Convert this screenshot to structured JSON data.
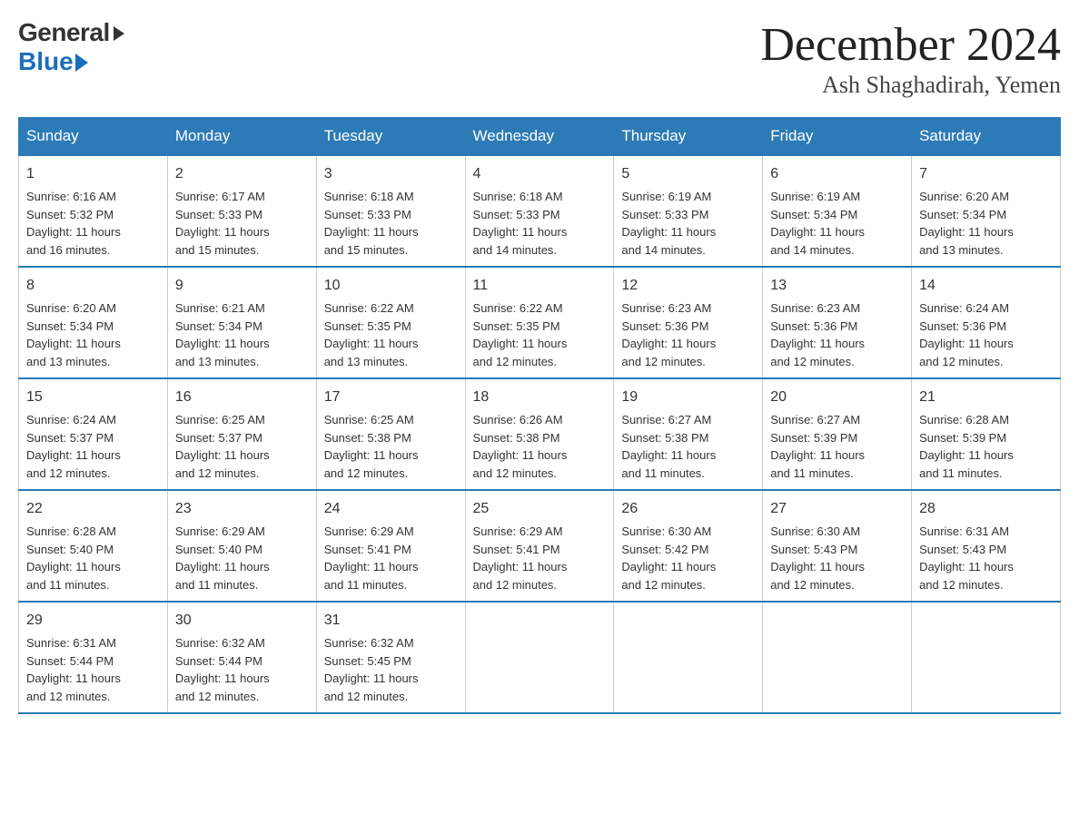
{
  "logo": {
    "general": "General",
    "blue": "Blue"
  },
  "title": {
    "month": "December 2024",
    "location": "Ash Shaghadirah, Yemen"
  },
  "headers": [
    "Sunday",
    "Monday",
    "Tuesday",
    "Wednesday",
    "Thursday",
    "Friday",
    "Saturday"
  ],
  "weeks": [
    [
      {
        "day": "1",
        "sunrise": "6:16 AM",
        "sunset": "5:32 PM",
        "daylight": "11 hours and 16 minutes."
      },
      {
        "day": "2",
        "sunrise": "6:17 AM",
        "sunset": "5:33 PM",
        "daylight": "11 hours and 15 minutes."
      },
      {
        "day": "3",
        "sunrise": "6:18 AM",
        "sunset": "5:33 PM",
        "daylight": "11 hours and 15 minutes."
      },
      {
        "day": "4",
        "sunrise": "6:18 AM",
        "sunset": "5:33 PM",
        "daylight": "11 hours and 14 minutes."
      },
      {
        "day": "5",
        "sunrise": "6:19 AM",
        "sunset": "5:33 PM",
        "daylight": "11 hours and 14 minutes."
      },
      {
        "day": "6",
        "sunrise": "6:19 AM",
        "sunset": "5:34 PM",
        "daylight": "11 hours and 14 minutes."
      },
      {
        "day": "7",
        "sunrise": "6:20 AM",
        "sunset": "5:34 PM",
        "daylight": "11 hours and 13 minutes."
      }
    ],
    [
      {
        "day": "8",
        "sunrise": "6:20 AM",
        "sunset": "5:34 PM",
        "daylight": "11 hours and 13 minutes."
      },
      {
        "day": "9",
        "sunrise": "6:21 AM",
        "sunset": "5:34 PM",
        "daylight": "11 hours and 13 minutes."
      },
      {
        "day": "10",
        "sunrise": "6:22 AM",
        "sunset": "5:35 PM",
        "daylight": "11 hours and 13 minutes."
      },
      {
        "day": "11",
        "sunrise": "6:22 AM",
        "sunset": "5:35 PM",
        "daylight": "11 hours and 12 minutes."
      },
      {
        "day": "12",
        "sunrise": "6:23 AM",
        "sunset": "5:36 PM",
        "daylight": "11 hours and 12 minutes."
      },
      {
        "day": "13",
        "sunrise": "6:23 AM",
        "sunset": "5:36 PM",
        "daylight": "11 hours and 12 minutes."
      },
      {
        "day": "14",
        "sunrise": "6:24 AM",
        "sunset": "5:36 PM",
        "daylight": "11 hours and 12 minutes."
      }
    ],
    [
      {
        "day": "15",
        "sunrise": "6:24 AM",
        "sunset": "5:37 PM",
        "daylight": "11 hours and 12 minutes."
      },
      {
        "day": "16",
        "sunrise": "6:25 AM",
        "sunset": "5:37 PM",
        "daylight": "11 hours and 12 minutes."
      },
      {
        "day": "17",
        "sunrise": "6:25 AM",
        "sunset": "5:38 PM",
        "daylight": "11 hours and 12 minutes."
      },
      {
        "day": "18",
        "sunrise": "6:26 AM",
        "sunset": "5:38 PM",
        "daylight": "11 hours and 12 minutes."
      },
      {
        "day": "19",
        "sunrise": "6:27 AM",
        "sunset": "5:38 PM",
        "daylight": "11 hours and 11 minutes."
      },
      {
        "day": "20",
        "sunrise": "6:27 AM",
        "sunset": "5:39 PM",
        "daylight": "11 hours and 11 minutes."
      },
      {
        "day": "21",
        "sunrise": "6:28 AM",
        "sunset": "5:39 PM",
        "daylight": "11 hours and 11 minutes."
      }
    ],
    [
      {
        "day": "22",
        "sunrise": "6:28 AM",
        "sunset": "5:40 PM",
        "daylight": "11 hours and 11 minutes."
      },
      {
        "day": "23",
        "sunrise": "6:29 AM",
        "sunset": "5:40 PM",
        "daylight": "11 hours and 11 minutes."
      },
      {
        "day": "24",
        "sunrise": "6:29 AM",
        "sunset": "5:41 PM",
        "daylight": "11 hours and 11 minutes."
      },
      {
        "day": "25",
        "sunrise": "6:29 AM",
        "sunset": "5:41 PM",
        "daylight": "11 hours and 12 minutes."
      },
      {
        "day": "26",
        "sunrise": "6:30 AM",
        "sunset": "5:42 PM",
        "daylight": "11 hours and 12 minutes."
      },
      {
        "day": "27",
        "sunrise": "6:30 AM",
        "sunset": "5:43 PM",
        "daylight": "11 hours and 12 minutes."
      },
      {
        "day": "28",
        "sunrise": "6:31 AM",
        "sunset": "5:43 PM",
        "daylight": "11 hours and 12 minutes."
      }
    ],
    [
      {
        "day": "29",
        "sunrise": "6:31 AM",
        "sunset": "5:44 PM",
        "daylight": "11 hours and 12 minutes."
      },
      {
        "day": "30",
        "sunrise": "6:32 AM",
        "sunset": "5:44 PM",
        "daylight": "11 hours and 12 minutes."
      },
      {
        "day": "31",
        "sunrise": "6:32 AM",
        "sunset": "5:45 PM",
        "daylight": "11 hours and 12 minutes."
      },
      null,
      null,
      null,
      null
    ]
  ],
  "labels": {
    "sunrise": "Sunrise:",
    "sunset": "Sunset:",
    "daylight": "Daylight:"
  }
}
